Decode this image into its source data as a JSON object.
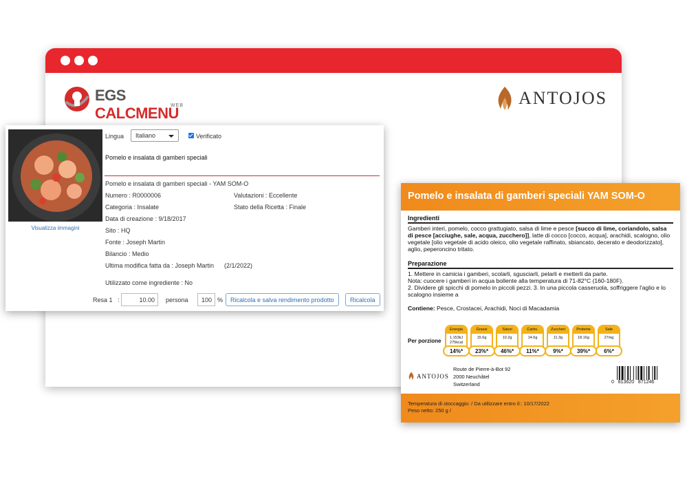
{
  "browser": {
    "accent": "#e8262d",
    "brand_left": {
      "name_a": "EGS",
      "name_b": "CALCMENU",
      "sub": "WEB"
    },
    "brand_right": "ANTOJOS"
  },
  "recipe_form": {
    "lang_label": "Lingua",
    "lang_value": "Italiano",
    "verified_label": "Verificato",
    "name": "Pomelo e insalata di gamberi speciali",
    "full_name": "Pomelo e insalata di gamberi speciali - YAM SOM-O",
    "number": "Numero : R0000006",
    "rating": "Valutazioni : Eccellente",
    "category": "Categoria : Insalate",
    "status": "Stato della Ricetta : Finale",
    "created": "Data di creazione : 9/18/2017",
    "site": "Sito : HQ",
    "source": "Fonte : Joseph Martin",
    "balance": "Bilancio : Medio",
    "last_modified": "Ultima modifica fatta da : Joseph Martin",
    "last_modified_date": "(2/1/2022)",
    "used_as_ingredient": "Utilizzato come ingrediente : No",
    "photo_link": "Visualizza immagini",
    "yield_label": "Resa 1",
    "yield_colon": ":",
    "yield_value": "10.00",
    "person_label": "persona",
    "percent_value": "100",
    "percent_sign": "%",
    "btn_recalc_save": "Ricalcola e salva rendimento prodotto",
    "btn_recalc": "Ricalcola"
  },
  "label": {
    "title": "Pomelo e insalata di gamberi speciali YAM SOM-O",
    "ingredients_title": "Ingredienti",
    "ingredients_a": "Gamberi interi, pomelo, cocco grattugiato, salsa di lime e pesce ",
    "ingredients_b": "[succo di lime, coriandolo, salsa di pesce [acciughe, sale, acqua, zucchero]]",
    "ingredients_c": ", latte di cocco [cocco, acqua], arachidi, scalogno, olio vegetale [olio vegetale di acido oleico, olio vegetale raffinato, sbiancato, decerato e deodorizzato], aglio, peperoncino tritato.",
    "prep_title": "Preparazione",
    "prep_1": "1. Mettere in camicia i gamberi, scolarli, sgusciarli, pelarli e metterli da parte.",
    "prep_2": "Nota: cuocere i gamberi in acqua bollente alla temperatura di 71-82°C (160-180F).",
    "prep_3": "2. Dividere gli spicchi di pomelo in piccoli pezzi. 3. In una piccola casseruola, soffriggere l'aglio e lo scalogno insieme a",
    "contains_label": "Contiene:",
    "contains_value": "Pesce, Crostacei, Arachidi, Noci di Macadamia",
    "per_portion": "Per porzione",
    "nutrients": [
      {
        "name": "Energia",
        "value": "1,153kJ 275kcal",
        "pct": "14%*"
      },
      {
        "name": "Grassi",
        "value": "15.6g",
        "pct": "23%*"
      },
      {
        "name": "Saturi",
        "value": "10.2g",
        "pct": "46%*"
      },
      {
        "name": "Carbs.",
        "value": "14.6g",
        "pct": "11%*"
      },
      {
        "name": "Zuccheri",
        "value": "11.3g",
        "pct": "9%*"
      },
      {
        "name": "Proteine",
        "value": "18.16g",
        "pct": "39%*"
      },
      {
        "name": "Sale",
        "value": "27mg",
        "pct": "6%*"
      }
    ],
    "brand": "ANTOJOS",
    "address_1": "Route de Pierre-à-Bot 92",
    "address_2": "2000 Neuchâtel",
    "address_3": "Switzerland",
    "barcode_digits": "0   813620   871246",
    "storage": "Temperatura di stoccaggio:  / Da utilizzare entro il:: 10/17/2022",
    "net_weight": "Peso netto: 250 g /",
    "accent": "#f08a1c",
    "badge_color": "#f3b21a"
  }
}
